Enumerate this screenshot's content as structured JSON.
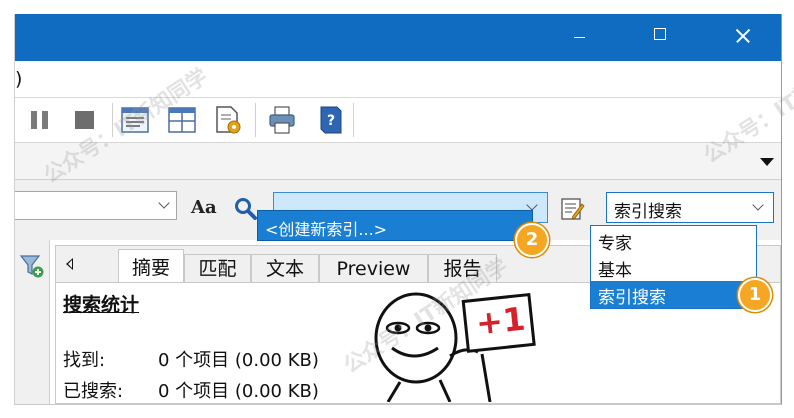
{
  "menu": {
    "partial_paren": ")"
  },
  "search": {
    "case_toggle_label": "Aa",
    "create_index_option": "<创建新索引...>"
  },
  "search_mode": {
    "selected": "索引搜索",
    "options": [
      "专家",
      "基本",
      "索引搜索"
    ]
  },
  "badges": {
    "mode_list": "1",
    "create_index": "2"
  },
  "tabs": [
    "摘要",
    "匹配",
    "文本",
    "Preview",
    "报告"
  ],
  "summary": {
    "title": "搜索统计",
    "rows": [
      {
        "label": "找到:",
        "value": "0 个项目 (0.00 KB)"
      },
      {
        "label": "已搜索:",
        "value": "0 个项目 (0.00 KB)"
      }
    ]
  },
  "sticker": {
    "sign_text": "+1"
  },
  "watermark": {
    "text": "公众号：IT新知同学"
  },
  "colors": {
    "titlebar": "#0f6cc0",
    "selection": "#1a7fd3",
    "badge": "#f5a623",
    "sign_red": "#d6202a"
  }
}
